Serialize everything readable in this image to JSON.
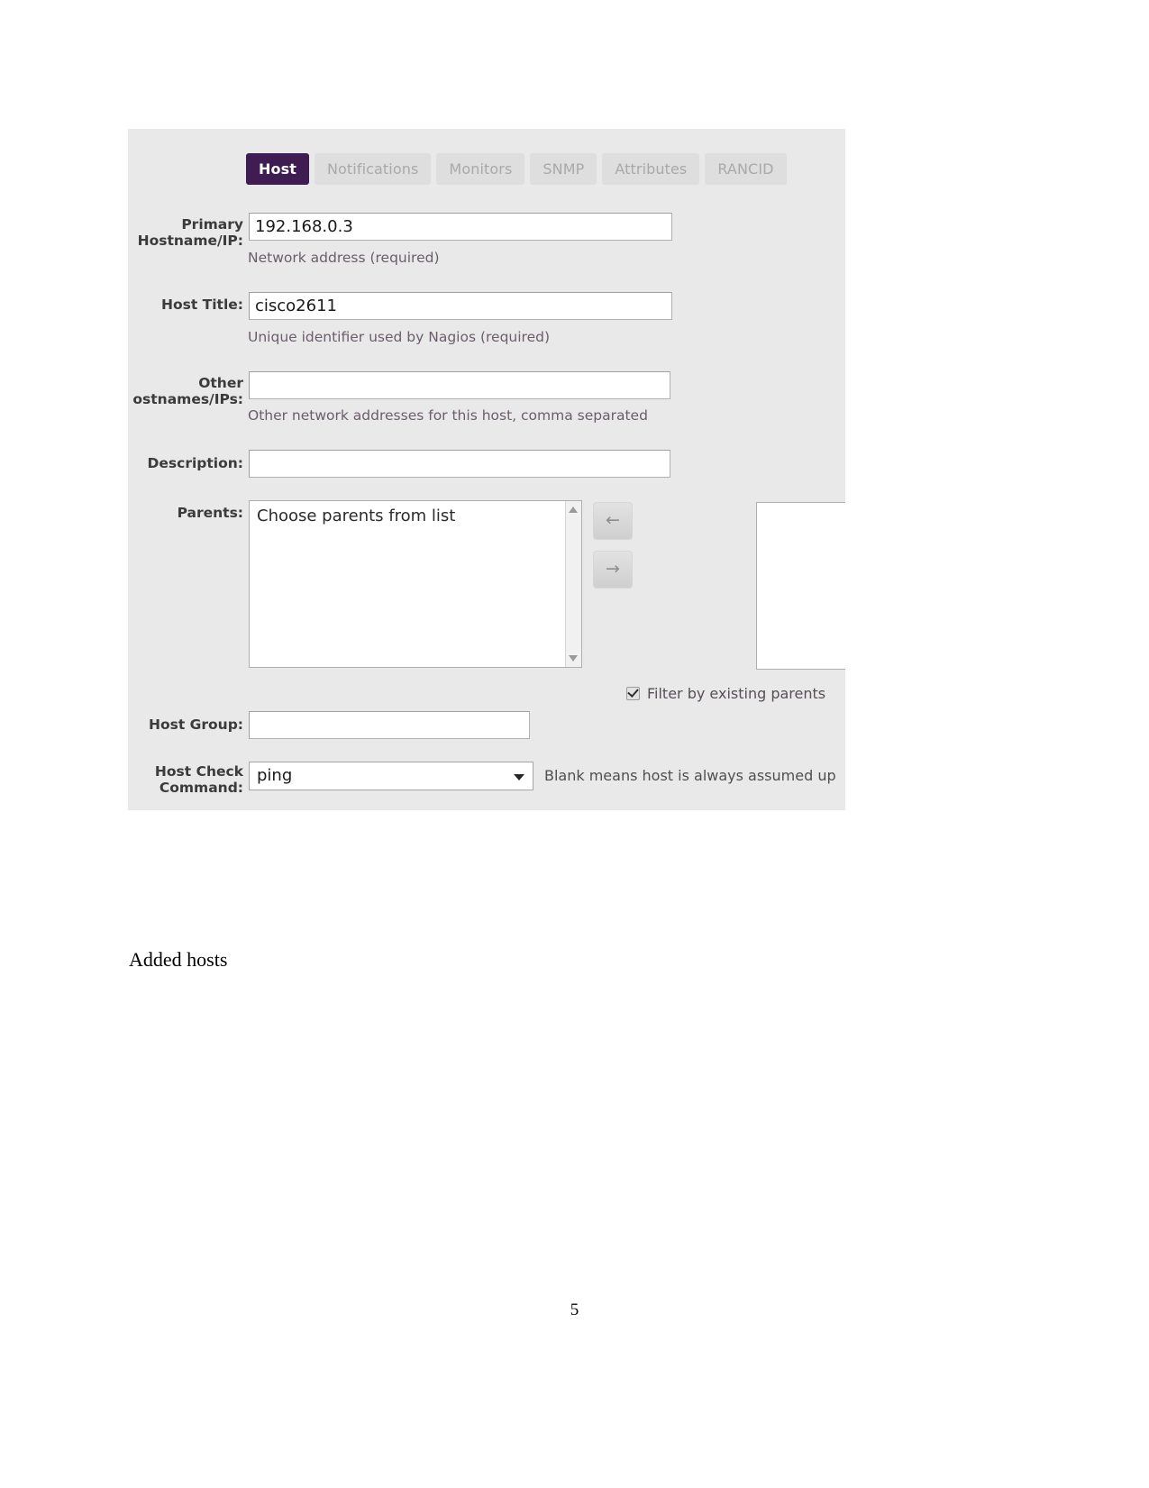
{
  "document": {
    "caption": "Added hosts",
    "page_number": "5"
  },
  "screenshot": {
    "tabs": [
      {
        "label": "Host",
        "active": true
      },
      {
        "label": "Notifications",
        "active": false
      },
      {
        "label": "Monitors",
        "active": false
      },
      {
        "label": "SNMP",
        "active": false
      },
      {
        "label": "Attributes",
        "active": false
      },
      {
        "label": "RANCID",
        "active": false
      }
    ],
    "colors": {
      "panel_background": "#e9e9e9",
      "active_tab": "#3f1d52",
      "inactive_tab": "#dedede",
      "helper_text": "#6b5d6b"
    },
    "fields": {
      "primary_hostname": {
        "label": "Primary\nHostname/IP:",
        "value": "192.168.0.3",
        "placeholder": "",
        "helper": "Network address (required)"
      },
      "host_title": {
        "label": "Host Title:",
        "value": "cisco2611",
        "placeholder": "",
        "helper": "Unique identifier used by Nagios (required)"
      },
      "other_hostnames": {
        "label": "Other\nostnames/IPs:",
        "value": "",
        "placeholder": "",
        "helper": "Other network addresses for this host, comma separated"
      },
      "description": {
        "label": "Description:",
        "value": "",
        "placeholder": ""
      },
      "parents": {
        "label": "Parents:",
        "available_placeholder": "Choose parents from list",
        "available_items": [],
        "selected_items": [],
        "move_left_icon": "arrow-left-icon",
        "move_right_icon": "arrow-right-icon",
        "move_left_glyph": "←",
        "move_right_glyph": "→",
        "filter_checkbox_label": "Filter by existing parents",
        "filter_checkbox_checked": true
      },
      "host_group": {
        "label": "Host Group:",
        "value": "",
        "placeholder": ""
      },
      "host_check_command": {
        "label": "Host Check\nCommand:",
        "value": "ping",
        "options": [
          "ping"
        ],
        "note": "Blank means host is always assumed up"
      }
    }
  }
}
